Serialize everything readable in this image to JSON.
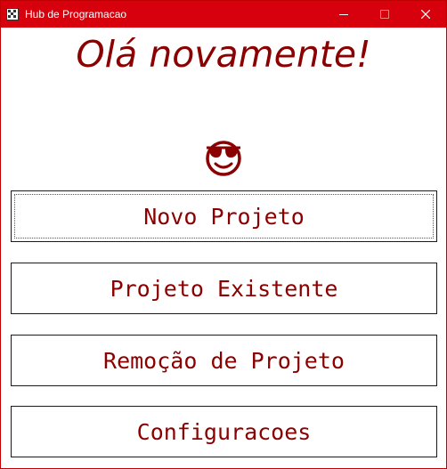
{
  "window": {
    "title": "Hub de Programacao",
    "icon": "grid-app-icon",
    "accent_color": "#d7000d",
    "text_color": "#8b0000"
  },
  "main": {
    "greeting": "Olá novamente!",
    "emoji": "smiling-face-with-sunglasses-icon",
    "buttons": [
      {
        "label": "Novo Projeto",
        "focused": true
      },
      {
        "label": "Projeto Existente",
        "focused": false
      },
      {
        "label": "Remoção de Projeto",
        "focused": false
      },
      {
        "label": "Configuracoes",
        "focused": false
      }
    ]
  }
}
